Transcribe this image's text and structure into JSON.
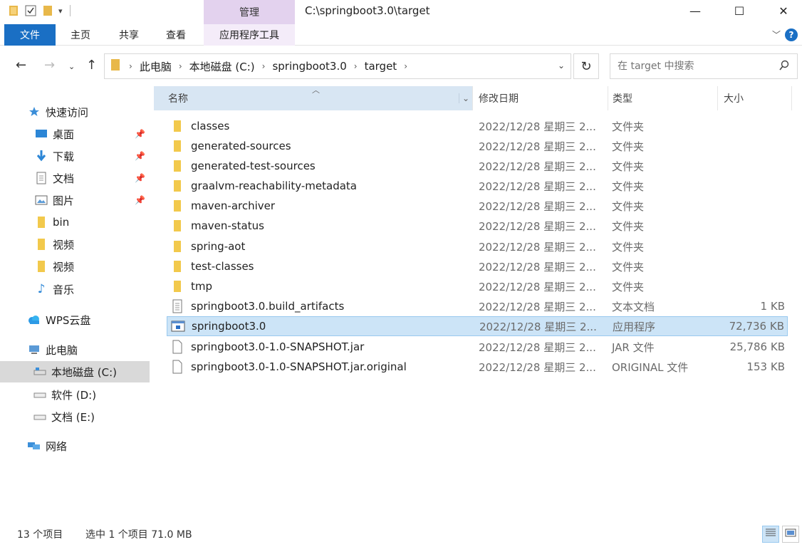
{
  "window": {
    "title": "C:\\springboot3.0\\target",
    "context_group": "管理",
    "minimize": "—",
    "maximize": "☐",
    "close": "✕"
  },
  "ribbon": {
    "tabs": [
      "文件",
      "主页",
      "共享",
      "查看",
      "应用程序工具"
    ],
    "help": "?"
  },
  "address": {
    "crumbs": [
      "此电脑",
      "本地磁盘 (C:)",
      "springboot3.0",
      "target"
    ],
    "search_placeholder": "在 target 中搜索"
  },
  "nav": {
    "items": [
      {
        "label": "快速访问",
        "icon": "star-icon"
      },
      {
        "label": "桌面",
        "icon": "desktop-icon",
        "pinned": true
      },
      {
        "label": "下载",
        "icon": "download-icon",
        "pinned": true
      },
      {
        "label": "文档",
        "icon": "document-icon",
        "pinned": true
      },
      {
        "label": "图片",
        "icon": "picture-icon",
        "pinned": true
      },
      {
        "label": "bin",
        "icon": "folder-icon"
      },
      {
        "label": "视频",
        "icon": "folder-icon"
      },
      {
        "label": "视频",
        "icon": "folder-icon"
      },
      {
        "label": "音乐",
        "icon": "music-icon"
      },
      {
        "label": "WPS云盘",
        "icon": "cloud-icon"
      },
      {
        "label": "此电脑",
        "icon": "computer-icon"
      },
      {
        "label": "本地磁盘 (C:)",
        "icon": "drive-icon",
        "selected": true
      },
      {
        "label": "软件 (D:)",
        "icon": "drive-icon"
      },
      {
        "label": "文档 (E:)",
        "icon": "drive-icon"
      },
      {
        "label": "网络",
        "icon": "network-icon"
      }
    ]
  },
  "columns": {
    "name": "名称",
    "date": "修改日期",
    "type": "类型",
    "size": "大小"
  },
  "files": [
    {
      "name": "classes",
      "date": "2022/12/28 星期三 2...",
      "type": "文件夹",
      "size": "",
      "icon": "folder-icon"
    },
    {
      "name": "generated-sources",
      "date": "2022/12/28 星期三 2...",
      "type": "文件夹",
      "size": "",
      "icon": "folder-icon"
    },
    {
      "name": "generated-test-sources",
      "date": "2022/12/28 星期三 2...",
      "type": "文件夹",
      "size": "",
      "icon": "folder-icon"
    },
    {
      "name": "graalvm-reachability-metadata",
      "date": "2022/12/28 星期三 2...",
      "type": "文件夹",
      "size": "",
      "icon": "folder-icon"
    },
    {
      "name": "maven-archiver",
      "date": "2022/12/28 星期三 2...",
      "type": "文件夹",
      "size": "",
      "icon": "folder-icon"
    },
    {
      "name": "maven-status",
      "date": "2022/12/28 星期三 2...",
      "type": "文件夹",
      "size": "",
      "icon": "folder-icon"
    },
    {
      "name": "spring-aot",
      "date": "2022/12/28 星期三 2...",
      "type": "文件夹",
      "size": "",
      "icon": "folder-icon"
    },
    {
      "name": "test-classes",
      "date": "2022/12/28 星期三 2...",
      "type": "文件夹",
      "size": "",
      "icon": "folder-icon"
    },
    {
      "name": "tmp",
      "date": "2022/12/28 星期三 2...",
      "type": "文件夹",
      "size": "",
      "icon": "folder-icon"
    },
    {
      "name": "springboot3.0.build_artifacts",
      "date": "2022/12/28 星期三 2...",
      "type": "文本文档",
      "size": "1 KB",
      "icon": "text-file-icon"
    },
    {
      "name": "springboot3.0",
      "date": "2022/12/28 星期三 2...",
      "type": "应用程序",
      "size": "72,736 KB",
      "icon": "application-icon",
      "selected": true
    },
    {
      "name": "springboot3.0-1.0-SNAPSHOT.jar",
      "date": "2022/12/28 星期三 2...",
      "type": "JAR 文件",
      "size": "25,786 KB",
      "icon": "file-icon"
    },
    {
      "name": "springboot3.0-1.0-SNAPSHOT.jar.original",
      "date": "2022/12/28 星期三 2...",
      "type": "ORIGINAL 文件",
      "size": "153 KB",
      "icon": "file-icon"
    }
  ],
  "status": {
    "count": "13 个项目",
    "selection": "选中 1 个项目 71.0 MB"
  },
  "colors": {
    "accent": "#1a6fc4",
    "context_tab": "#e3d2ee",
    "selection": "#cce4f7",
    "folder": "#f2c94c"
  }
}
